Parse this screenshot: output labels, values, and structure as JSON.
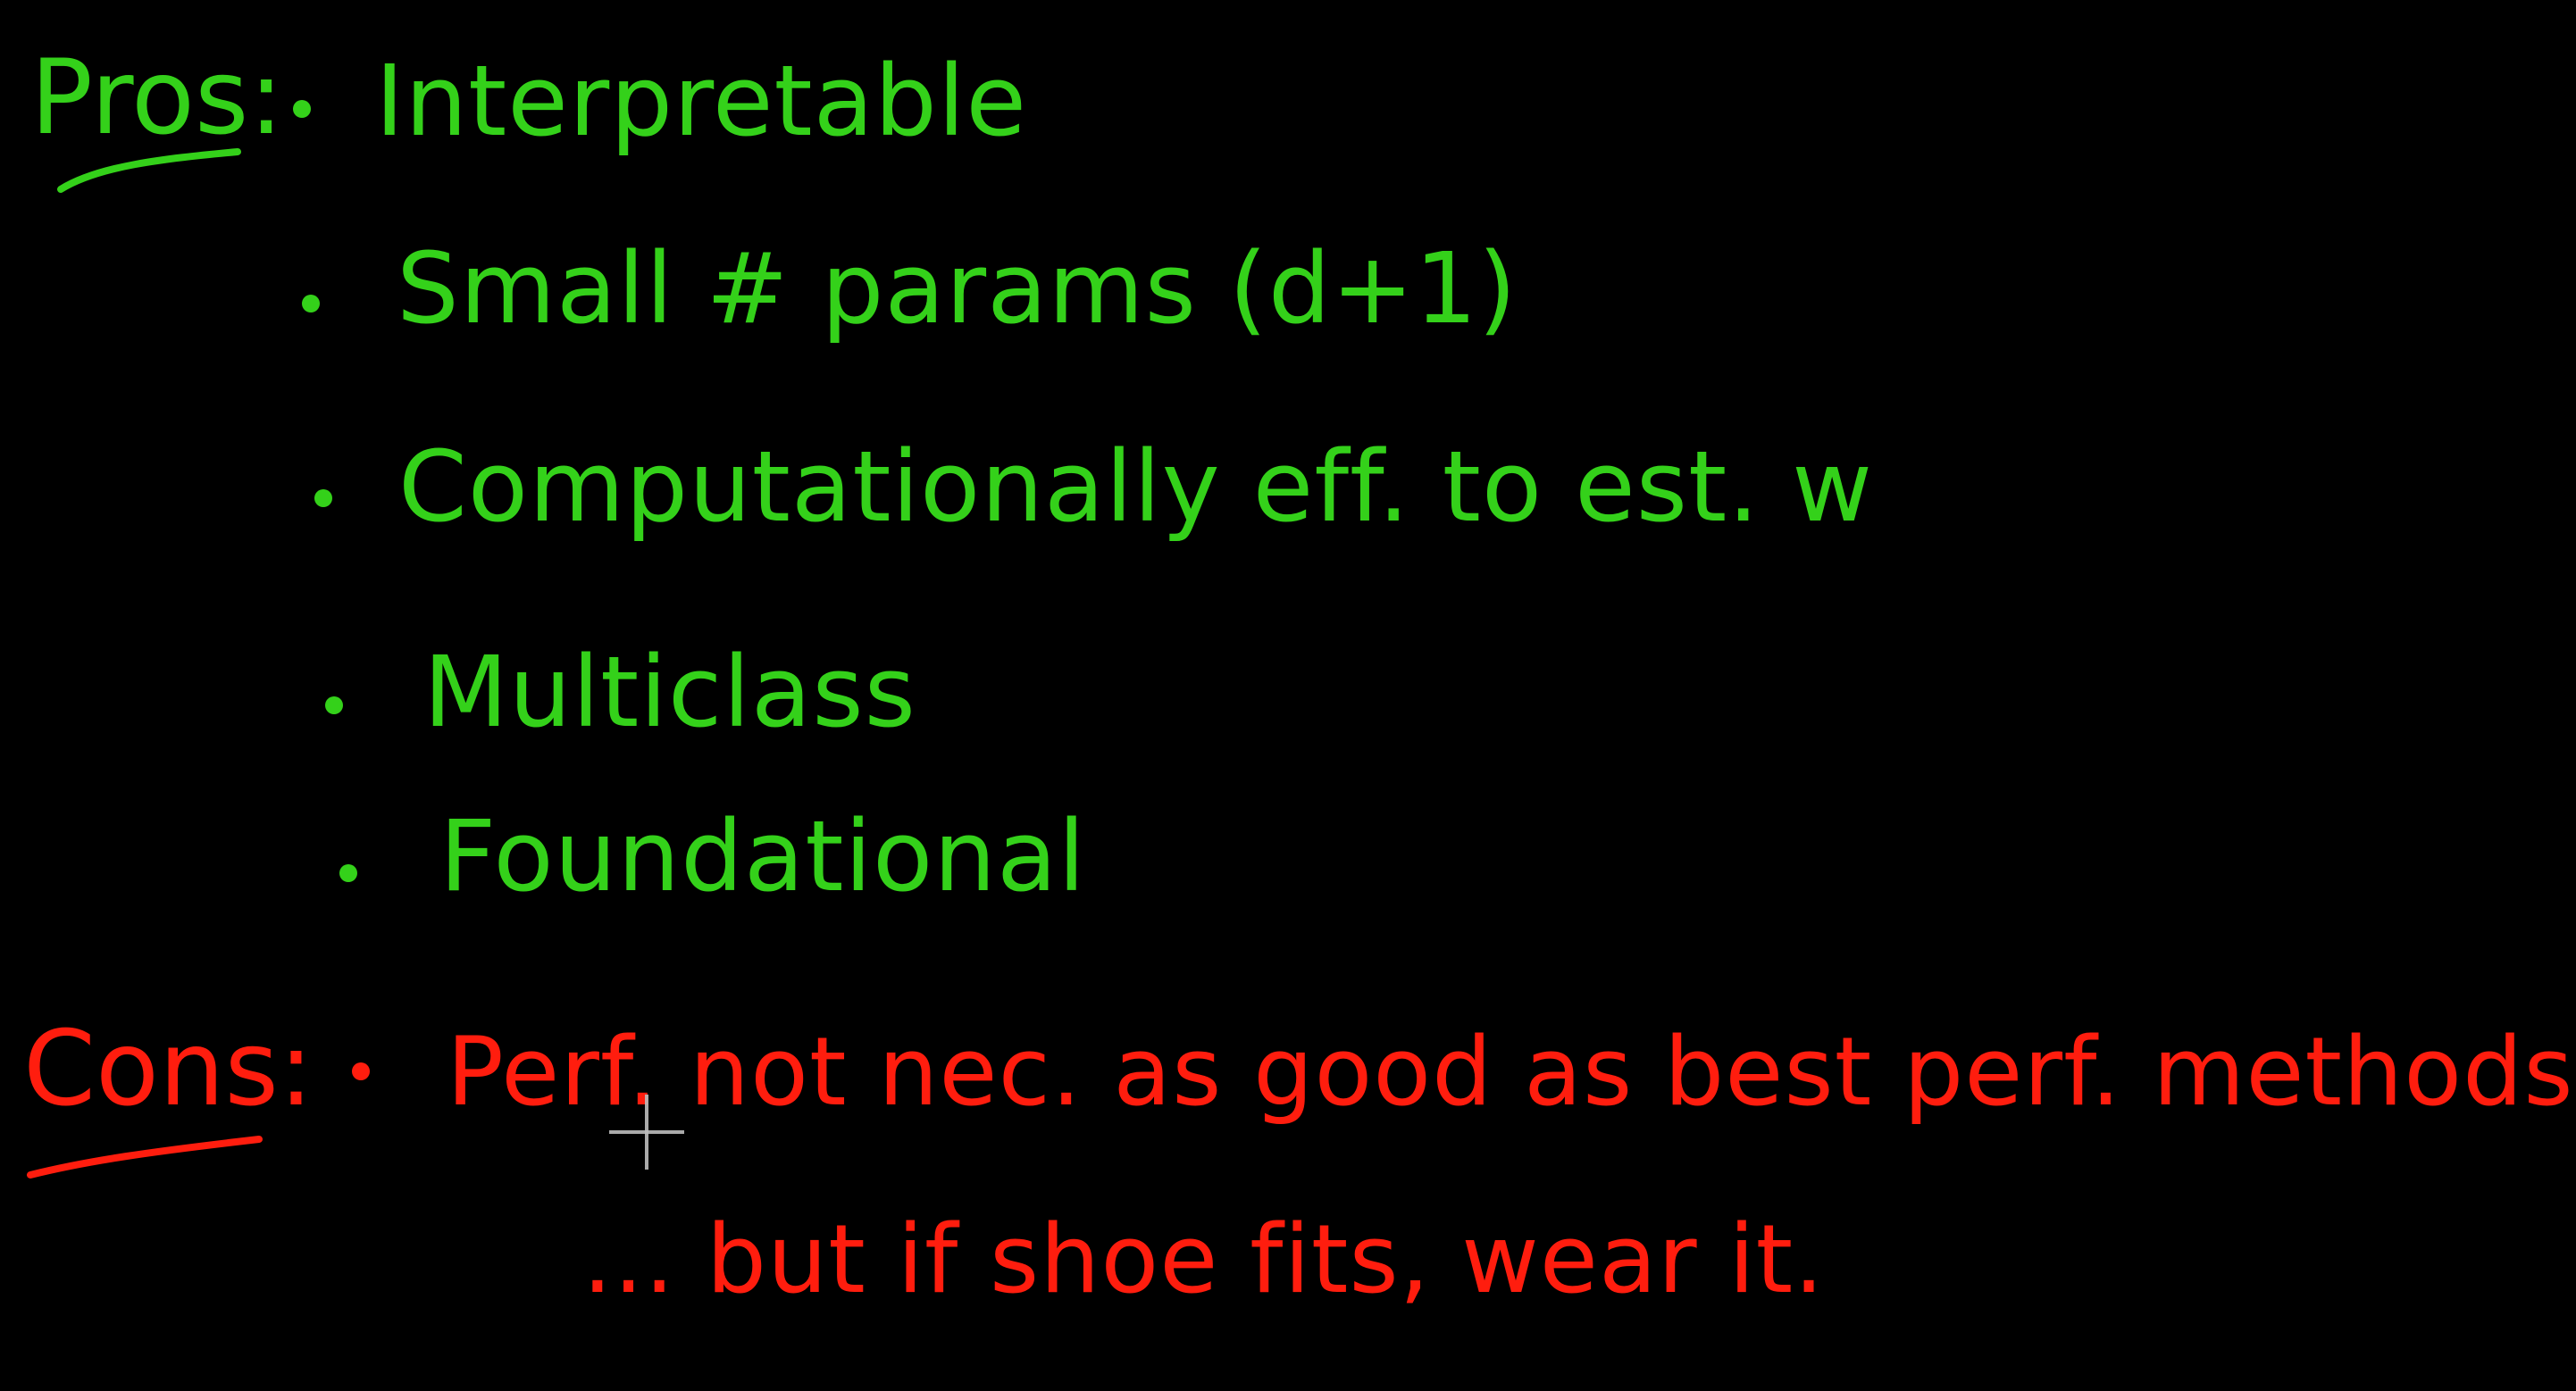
{
  "colors": {
    "green": "#34d11a",
    "red": "#ff1d0e",
    "background": "#000000",
    "cursor": "#bdbdbd"
  },
  "pros": {
    "label": "Pros:",
    "items": [
      "Interpretable",
      "Small # params (d+1)",
      "Computationally eff. to est. w",
      "Multiclass",
      "Foundational"
    ]
  },
  "cons": {
    "label": "Cons:",
    "items": [
      "Perf. not nec. as good as best perf. methods",
      "... but if shoe fits, wear it."
    ]
  }
}
